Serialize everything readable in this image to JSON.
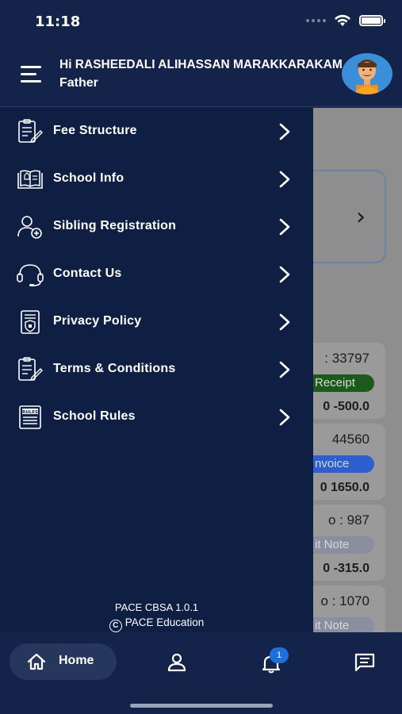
{
  "status_bar": {
    "time": "11:18"
  },
  "header": {
    "greeting": "Hi RASHEEDALI ALIHASSAN MARAKKARAKAM",
    "role": "Father"
  },
  "menu": {
    "items": [
      {
        "label": "Fee Structure",
        "icon": "fee-structure-icon"
      },
      {
        "label": "School Info",
        "icon": "school-info-icon"
      },
      {
        "label": "Sibling Registration",
        "icon": "sibling-registration-icon"
      },
      {
        "label": "Contact Us",
        "icon": "headset-icon"
      },
      {
        "label": "Privacy Policy",
        "icon": "privacy-policy-icon"
      },
      {
        "label": "Terms & Conditions",
        "icon": "terms-icon"
      },
      {
        "label": "School Rules",
        "icon": "rules-icon"
      }
    ],
    "rules_badge_text": "RULES"
  },
  "footer": {
    "version": "PACE CBSA 1.0.1",
    "copyright": "PACE Education"
  },
  "background": {
    "items": [
      {
        "number": ": 33797",
        "tag": "Receipt",
        "amount": "0 -500.0",
        "tag_color": "#1c5a1c"
      },
      {
        "number": "44560",
        "tag": "nvoice",
        "amount": "0 1650.0",
        "tag_color": "#2d5fd0"
      },
      {
        "number": "o : 987",
        "tag": "it Note",
        "amount": "0 -315.0",
        "tag_color": "#8a8fa0"
      },
      {
        "number": "o : 1070",
        "tag": "it Note",
        "amount": "",
        "tag_color": "#8a8fa0"
      }
    ]
  },
  "bottom_nav": {
    "home_label": "Home",
    "notification_count": "1"
  },
  "colors": {
    "background": "#0f1f44",
    "header": "#13234a",
    "accent": "#1e6fd9"
  }
}
